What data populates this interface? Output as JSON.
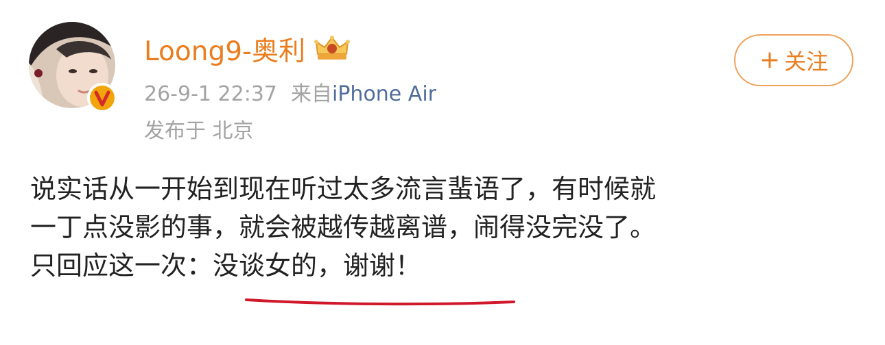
{
  "colors": {
    "username": "#ea7d1f",
    "meta_text": "#a3a3a3",
    "source_link": "#4f6d9a",
    "body_text": "#222222",
    "follow_border": "#f0a15a",
    "underline": "#d0182b",
    "verified_badge": "#f2a40b"
  },
  "user": {
    "name": "Loong9-奥利",
    "avatar_icon": "user-avatar",
    "verified_icon": "verified-v-badge-icon",
    "crown_icon": "crown-badge-icon"
  },
  "meta": {
    "timestamp": "26-9-1 22:37",
    "source_prefix": "来自",
    "source_device": "iPhone Air",
    "location": "发布于 北京"
  },
  "follow_button": {
    "plus": "+",
    "label": "关注"
  },
  "post": {
    "line1": "说实话从一开始到现在听过太多流言蜚语了，有时候就",
    "line2": "一丁点没影的事，就会被越传越离谱，闹得没完没了。",
    "line3": "只回应这一次：没谈女的，谢谢！"
  }
}
